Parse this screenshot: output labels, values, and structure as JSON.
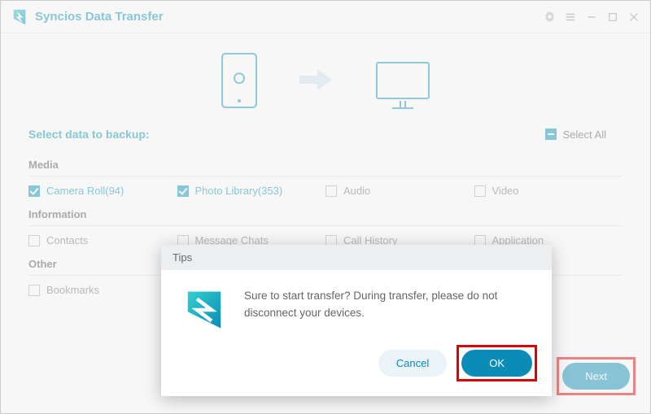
{
  "app": {
    "title": "Syncios Data Transfer"
  },
  "heading": "Select data to backup:",
  "selectAll": "Select All",
  "sections": {
    "media": "Media",
    "info": "Information",
    "other": "Other"
  },
  "items": {
    "cameraRoll": "Camera Roll(94)",
    "photoLibrary": "Photo Library(353)",
    "audio": "Audio",
    "video": "Video",
    "contacts": "Contacts",
    "messageChats": "Message Chats",
    "callHistory": "Call History",
    "application": "Application",
    "bookmarks": "Bookmarks"
  },
  "buttons": {
    "next": "Next",
    "cancel": "Cancel",
    "ok": "OK"
  },
  "dialog": {
    "title": "Tips",
    "message": "Sure to start transfer? During transfer, please do not disconnect your devices."
  }
}
